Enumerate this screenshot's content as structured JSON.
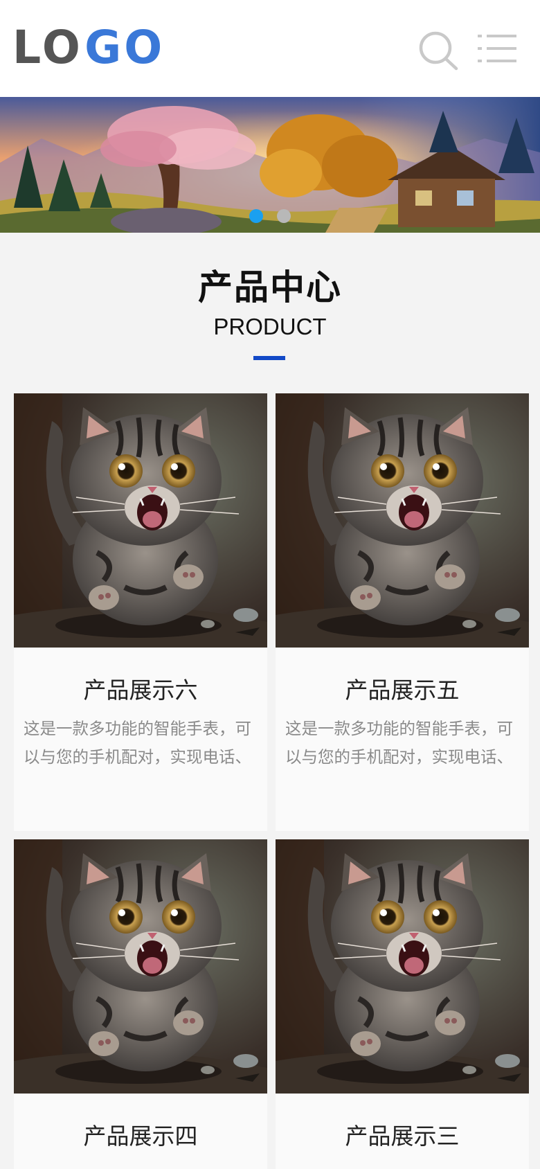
{
  "header": {
    "logo_part1": "LO",
    "logo_part2": "GO",
    "search_icon": "search-icon",
    "menu_icon": "menu-icon"
  },
  "banner": {
    "dots": 2,
    "active_dot": 0,
    "colors": {
      "active": "#1aa0f0",
      "inactive": "#b8b8b8"
    }
  },
  "section": {
    "title": "产品中心",
    "subtitle": "PRODUCT",
    "accent": "#1249c7"
  },
  "products": [
    {
      "title": "产品展示六",
      "desc": "这是一款多功能的智能手表，可以与您的手机配对，实现电话、"
    },
    {
      "title": "产品展示五",
      "desc": "这是一款多功能的智能手表，可以与您的手机配对，实现电话、"
    },
    {
      "title": "产品展示四",
      "desc": ""
    },
    {
      "title": "产品展示三",
      "desc": ""
    }
  ]
}
